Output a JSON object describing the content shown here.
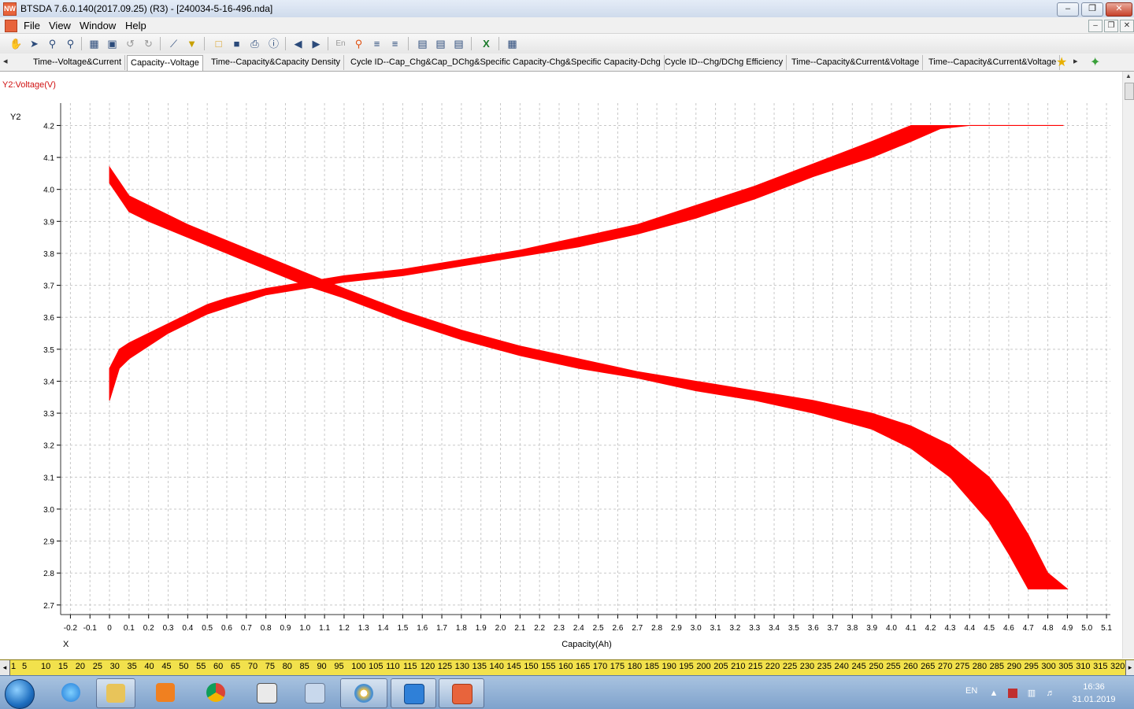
{
  "window": {
    "app_icon": "bts-app-icon",
    "title": "BTSDA 7.6.0.140(2017.09.25) (R3) - [240034-5-16-496.nda]",
    "controls": {
      "minimize": "–",
      "restore": "❐",
      "close": "✕"
    }
  },
  "menu": {
    "items": [
      "File",
      "View",
      "Window",
      "Help"
    ],
    "mdi_controls": {
      "minimize": "–",
      "restore": "❐",
      "close": "✕"
    }
  },
  "toolbar": {
    "icons": [
      "hand-icon",
      "pointer-icon",
      "zoom-rect-icon",
      "zoom-icon",
      "report-icon",
      "layout-icon",
      "undo-icon",
      "redo-icon",
      "cursor-line-icon",
      "filter-icon",
      "open-folder-icon",
      "save-icon",
      "print-icon",
      "help-icon",
      "back-icon",
      "forward-icon",
      "language-icon",
      "marker-icon",
      "align-left-icon",
      "align-right-icon",
      "table-icon",
      "table2-icon",
      "table3-icon",
      "excel-icon",
      "grid-icon"
    ]
  },
  "tabs": {
    "items": [
      "Time--Voltage&Current",
      "Capacity--Voltage",
      "Time--Capacity&Capacity Density",
      "Cycle ID--Cap_Chg&Cap_DChg&Specific Capacity-Chg&Specific Capacity-Dchg",
      "Cycle ID--Chg/DChg Efficiency",
      "Time--Capacity&Current&Voltage",
      "Time--Capacity&Current&Voltage"
    ],
    "active_index": 1,
    "scroll_left": "◂",
    "scroll_right": "▸",
    "star_icon": "★",
    "add_icon": "✦"
  },
  "chart_data": {
    "type": "line",
    "series_label": "Y2:Voltage(V)",
    "y_axis_name": "Y2",
    "x_axis_name": "X",
    "xlabel": "Capacity(Ah)",
    "x_ticks": [
      "-0.2",
      "-0.1",
      "0",
      "0.1",
      "0.2",
      "0.3",
      "0.4",
      "0.5",
      "0.6",
      "0.7",
      "0.8",
      "0.9",
      "1.0",
      "1.1",
      "1.2",
      "1.3",
      "1.4",
      "1.5",
      "1.6",
      "1.7",
      "1.8",
      "1.9",
      "2.0",
      "2.1",
      "2.2",
      "2.3",
      "2.4",
      "2.5",
      "2.6",
      "2.7",
      "2.8",
      "2.9",
      "3.0",
      "3.1",
      "3.2",
      "3.3",
      "3.4",
      "3.5",
      "3.6",
      "3.7",
      "3.8",
      "3.9",
      "4.0",
      "4.1",
      "4.2",
      "4.3",
      "4.4",
      "4.5",
      "4.6",
      "4.7",
      "4.8",
      "4.9",
      "5.0",
      "5.1"
    ],
    "y_ticks": [
      "2.7",
      "2.8",
      "2.9",
      "3.0",
      "3.1",
      "3.2",
      "3.3",
      "3.4",
      "3.5",
      "3.6",
      "3.7",
      "3.8",
      "3.9",
      "4.0",
      "4.1",
      "4.2"
    ],
    "xlim": [
      -0.25,
      5.12
    ],
    "ylim": [
      2.67,
      4.27
    ],
    "grid": true,
    "color": "#ff0000",
    "charge_band": {
      "x": [
        0.0,
        0.05,
        0.1,
        0.2,
        0.3,
        0.4,
        0.5,
        0.6,
        0.8,
        1.0,
        1.2,
        1.5,
        1.8,
        2.1,
        2.4,
        2.7,
        3.0,
        3.3,
        3.6,
        3.9,
        4.1,
        4.25,
        4.4
      ],
      "upper": [
        3.44,
        3.5,
        3.52,
        3.55,
        3.58,
        3.61,
        3.64,
        3.66,
        3.69,
        3.71,
        3.73,
        3.75,
        3.78,
        3.81,
        3.85,
        3.89,
        3.95,
        4.01,
        4.08,
        4.15,
        4.2,
        4.2,
        4.2
      ],
      "lower": [
        3.34,
        3.44,
        3.47,
        3.51,
        3.55,
        3.58,
        3.61,
        3.63,
        3.67,
        3.69,
        3.71,
        3.73,
        3.76,
        3.79,
        3.82,
        3.86,
        3.91,
        3.97,
        4.04,
        4.1,
        4.15,
        4.19,
        4.2
      ]
    },
    "charge_cv_line": {
      "x": [
        4.4,
        4.88
      ],
      "y": [
        4.2,
        4.2
      ]
    },
    "discharge_band": {
      "x": [
        0.0,
        0.1,
        0.2,
        0.4,
        0.6,
        0.8,
        1.0,
        1.2,
        1.5,
        1.8,
        2.1,
        2.4,
        2.7,
        3.0,
        3.3,
        3.6,
        3.9,
        4.1,
        4.3,
        4.5,
        4.6,
        4.7,
        4.8,
        4.9
      ],
      "upper": [
        4.07,
        3.98,
        3.95,
        3.89,
        3.84,
        3.79,
        3.74,
        3.69,
        3.62,
        3.56,
        3.51,
        3.47,
        3.43,
        3.4,
        3.37,
        3.34,
        3.3,
        3.26,
        3.2,
        3.1,
        3.02,
        2.92,
        2.8,
        2.75
      ],
      "lower": [
        4.02,
        3.93,
        3.9,
        3.85,
        3.8,
        3.75,
        3.7,
        3.66,
        3.59,
        3.53,
        3.48,
        3.44,
        3.41,
        3.37,
        3.34,
        3.3,
        3.25,
        3.19,
        3.1,
        2.96,
        2.86,
        2.75,
        2.75,
        2.75
      ]
    }
  },
  "ruler": {
    "labels": [
      "1",
      "5",
      "10",
      "15",
      "20",
      "25",
      "30",
      "35",
      "40",
      "45",
      "50",
      "55",
      "60",
      "65",
      "70",
      "75",
      "80",
      "85",
      "90",
      "95",
      "100",
      "105",
      "110",
      "115",
      "120",
      "125",
      "130",
      "135",
      "140",
      "145",
      "150",
      "155",
      "160",
      "165",
      "170",
      "175",
      "180",
      "185",
      "190",
      "195",
      "200",
      "205",
      "210",
      "215",
      "220",
      "225",
      "230",
      "235",
      "240",
      "245",
      "250",
      "255",
      "260",
      "265",
      "270",
      "275",
      "280",
      "285",
      "290",
      "295",
      "300",
      "305",
      "310",
      "315",
      "320"
    ],
    "left_arrow": "◂",
    "right_arrow": "▸"
  },
  "taskbar": {
    "apps": [
      "ie-icon",
      "explorer-icon",
      "media-player-icon",
      "chrome-icon",
      "app-box-icon",
      "calculator-icon",
      "paint-icon",
      "bts-client-icon",
      "bts-da-icon"
    ],
    "language": "EN",
    "time": "16:36",
    "date": "31.01.2019"
  }
}
